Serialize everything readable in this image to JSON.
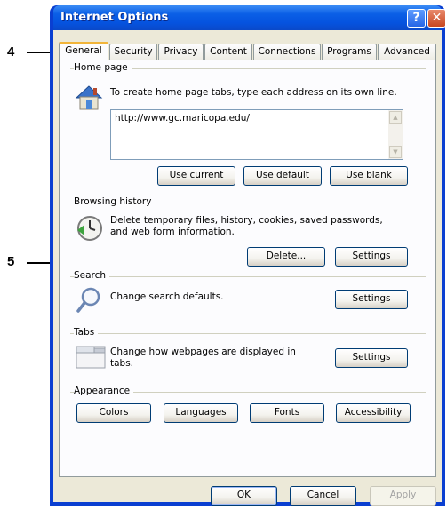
{
  "window": {
    "title": "Internet Options"
  },
  "tabs": [
    "General",
    "Security",
    "Privacy",
    "Content",
    "Connections",
    "Programs",
    "Advanced"
  ],
  "home_page": {
    "label": "Home page",
    "description": "To create home page tabs, type each address on its own line.",
    "url": "http://www.gc.maricopa.edu/",
    "buttons": {
      "use_current": "Use current",
      "use_default": "Use default",
      "use_blank": "Use blank"
    }
  },
  "browsing_history": {
    "label": "Browsing history",
    "description_1": "Delete temporary files, history, cookies, saved passwords,",
    "description_2": "and web form information.",
    "delete_label": "Delete...",
    "settings_label": "Settings"
  },
  "search": {
    "label": "Search",
    "description": "Change search defaults.",
    "settings_label": "Settings"
  },
  "tabs_group": {
    "label": "Tabs",
    "description_1": "Change how webpages are displayed in",
    "description_2": "tabs.",
    "settings_label": "Settings"
  },
  "appearance": {
    "label": "Appearance",
    "buttons": [
      "Colors",
      "Languages",
      "Fonts",
      "Accessibility"
    ]
  },
  "footer": {
    "ok": "OK",
    "cancel": "Cancel",
    "apply": "Apply"
  },
  "annotations": {
    "step_4": "4",
    "step_5": "5"
  },
  "colors": {
    "title_bar": "#0553df",
    "dialog_bg": "#ece9d8",
    "panel_bg": "#fcfcfe",
    "tab_highlight": "#f2b53a"
  }
}
